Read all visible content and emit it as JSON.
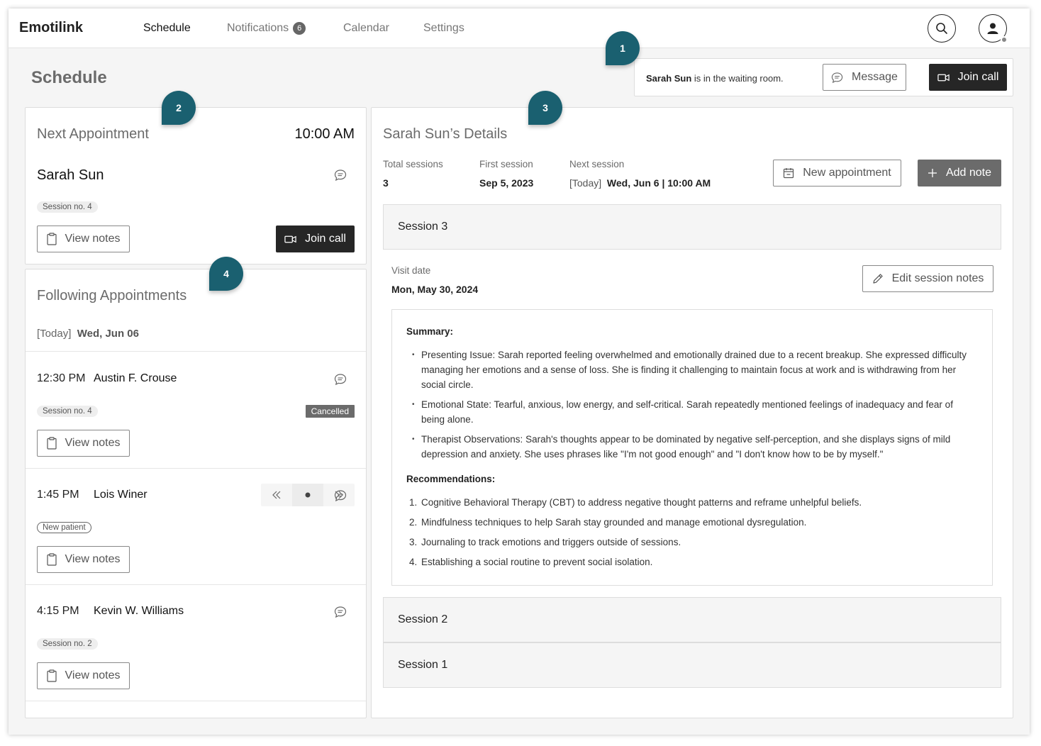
{
  "app": {
    "brand": "Emotilink"
  },
  "nav": [
    {
      "label": "Schedule"
    },
    {
      "label": "Notifications",
      "badge": "6"
    },
    {
      "label": "Calendar"
    },
    {
      "label": "Settings"
    }
  ],
  "page": {
    "title": "Schedule"
  },
  "markers": [
    "1",
    "2",
    "3",
    "4"
  ],
  "waiting": {
    "name": "Sarah Sun",
    "text": "is in the waiting room.",
    "message_label": "Message",
    "join_label": "Join call"
  },
  "next_appointment": {
    "heading": "Next Appointment",
    "time": "10:00 AM",
    "patient": "Sarah Sun",
    "session_tag": "Session no. 4",
    "view_notes_label": "View notes",
    "join_label": "Join call"
  },
  "following": {
    "heading": "Following Appointments",
    "today_tag": "[Today]",
    "date": "Wed, Jun 06",
    "items": [
      {
        "time": "12:30 PM",
        "name": "Austin F. Crouse",
        "tag": "Session no. 4",
        "status": "Cancelled",
        "view_notes_label": "View notes"
      },
      {
        "time": "1:45 PM",
        "name": "Lois Winer",
        "tag": "New patient",
        "view_notes_label": "View notes"
      },
      {
        "time": "4:15 PM",
        "name": "Kevin W. Williams",
        "tag": "Session no. 2",
        "view_notes_label": "View notes"
      }
    ]
  },
  "details": {
    "heading": "Sarah Sun’s Details",
    "stats": [
      {
        "label": "Total sessions",
        "value": "3"
      },
      {
        "label": "First session",
        "value": "Sep 5, 2023"
      },
      {
        "label": "Next session",
        "prefix": "[Today]",
        "value": "Wed, Jun 6 | 10:00 AM"
      }
    ],
    "new_appointment_label": "New appointment",
    "add_note_label": "Add note",
    "sessions": [
      {
        "title": "Session 3"
      },
      {
        "title": "Session 2"
      },
      {
        "title": "Session 1"
      }
    ],
    "visit_date_label": "Visit date",
    "visit_date": "Mon, May 30, 2024",
    "edit_notes_label": "Edit session notes",
    "summary_heading": "Summary:",
    "summary": [
      "Presenting Issue: Sarah reported feeling overwhelmed and emotionally drained due to a recent breakup. She expressed difficulty managing her emotions and a sense of loss. She is finding it challenging to maintain focus at work and is withdrawing from her social circle.",
      "Emotional State: Tearful, anxious, low energy, and self-critical. Sarah repeatedly mentioned feelings of inadequacy and fear of being alone.",
      "Therapist Observations: Sarah's thoughts appear to be dominated by negative self-perception, and she displays signs of mild depression and anxiety. She uses phrases like \"I'm not good enough\" and \"I don't know how to be by myself.\""
    ],
    "recommendations_heading": "Recommendations:",
    "recommendations": [
      "Cognitive Behavioral Therapy (CBT) to address negative thought patterns and reframe unhelpful beliefs.",
      "Mindfulness techniques to help Sarah stay grounded and manage emotional dysregulation.",
      "Journaling to track emotions and triggers outside of sessions.",
      "Establishing a social routine to prevent social isolation."
    ]
  },
  "colors": {
    "marker": "#1a6070",
    "dark_button": "#262626",
    "gray_button": "#6b6b6b"
  }
}
